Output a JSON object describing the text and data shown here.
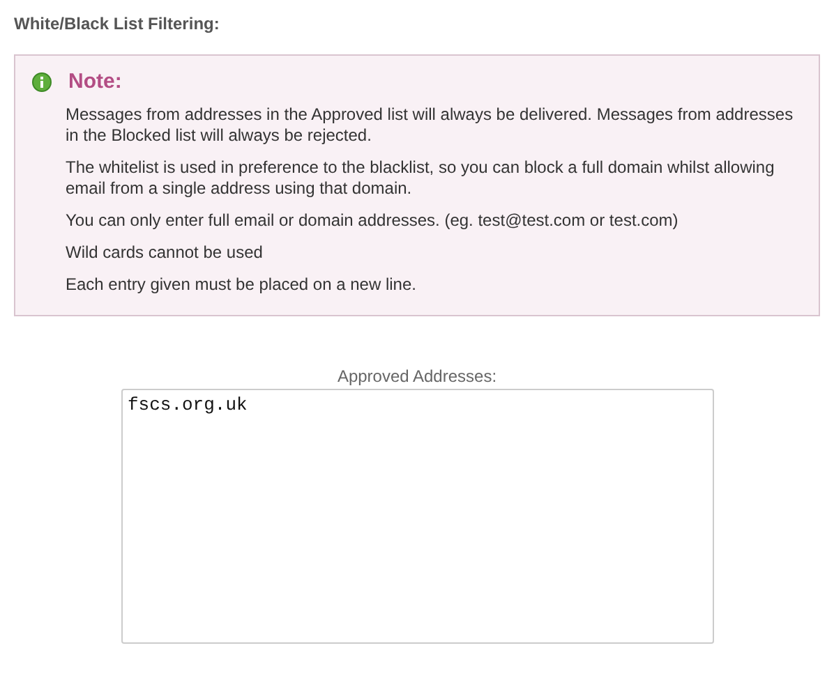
{
  "heading": "White/Black List Filtering:",
  "note": {
    "title": "Note:",
    "paragraphs": [
      "Messages from addresses in the Approved list will always be delivered. Messages from addresses in the Blocked list will always be rejected.",
      "The whitelist is used in preference to the blacklist, so you can block a full domain whilst allowing email from a single address using that domain.",
      "You can only enter full email or domain addresses. (eg. test@test.com or test.com)",
      "Wild cards cannot be used",
      "Each entry given must be placed on a new line."
    ]
  },
  "approved": {
    "label": "Approved Addresses:",
    "value": "fscs.org.uk"
  }
}
